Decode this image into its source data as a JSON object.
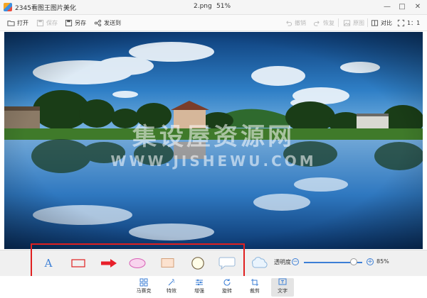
{
  "window": {
    "app_title": "2345看图王图片美化",
    "file_name": "2.png",
    "zoom": "51%"
  },
  "toolbar": {
    "open": "打开",
    "save": "保存",
    "save_as": "另存",
    "send_to": "发送到",
    "undo": "撤销",
    "redo": "恢复",
    "watermark": "原图",
    "compare": "对比",
    "ratio": "1：1"
  },
  "watermark": {
    "cn": "集设屋资源网",
    "en": "WWW.JISHEWU.COM"
  },
  "draw_panel": {
    "text_tool_glyph": "A",
    "opacity_label": "透明度",
    "opacity_percent": 85,
    "opacity_value": "85%"
  },
  "bottom_tools": [
    {
      "label": "马赛克"
    },
    {
      "label": "特效"
    },
    {
      "label": "增强"
    },
    {
      "label": "旋转"
    },
    {
      "label": "裁剪"
    },
    {
      "label": "文字",
      "active": true
    }
  ],
  "colors": {
    "accent": "#3c7fd6",
    "highlight_border": "#e02020",
    "arrow": "#e8202a"
  }
}
